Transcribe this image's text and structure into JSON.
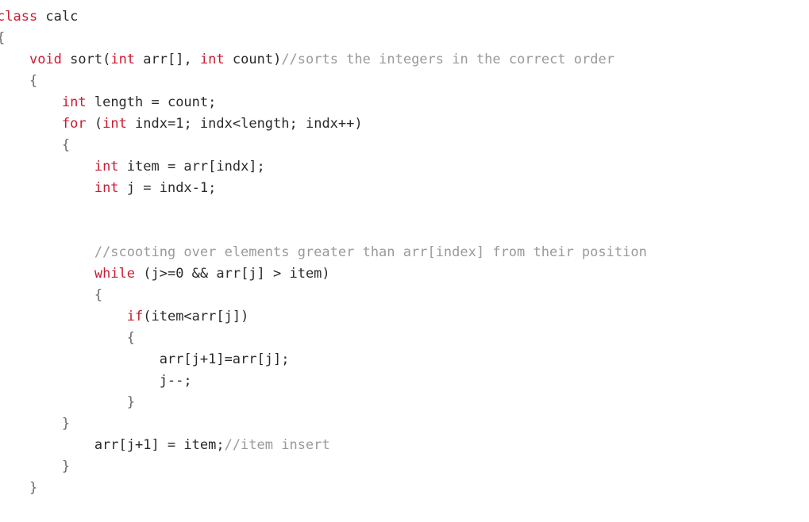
{
  "colors": {
    "background": "#ffffff",
    "keyword": "#cc1b30",
    "comment": "#9a9a9a",
    "text": "#2a2a2a",
    "punctuation": "#6a6a6a"
  },
  "code": {
    "lines": [
      [
        {
          "t": "kw",
          "v": "class"
        },
        {
          "t": "plain",
          "v": " calc"
        }
      ],
      [
        {
          "t": "punct",
          "v": "{"
        }
      ],
      [
        {
          "t": "plain",
          "v": "    "
        },
        {
          "t": "kw",
          "v": "void"
        },
        {
          "t": "plain",
          "v": " sort("
        },
        {
          "t": "kw",
          "v": "int"
        },
        {
          "t": "plain",
          "v": " arr[], "
        },
        {
          "t": "kw",
          "v": "int"
        },
        {
          "t": "plain",
          "v": " count)"
        },
        {
          "t": "cm",
          "v": "//sorts the integers in the correct order"
        }
      ],
      [
        {
          "t": "plain",
          "v": "    "
        },
        {
          "t": "punct",
          "v": "{"
        }
      ],
      [
        {
          "t": "plain",
          "v": "        "
        },
        {
          "t": "kw",
          "v": "int"
        },
        {
          "t": "plain",
          "v": " length = count;"
        }
      ],
      [
        {
          "t": "plain",
          "v": "        "
        },
        {
          "t": "kw",
          "v": "for"
        },
        {
          "t": "plain",
          "v": " ("
        },
        {
          "t": "kw",
          "v": "int"
        },
        {
          "t": "plain",
          "v": " indx=1; indx<length; indx++)"
        }
      ],
      [
        {
          "t": "plain",
          "v": "        "
        },
        {
          "t": "punct",
          "v": "{"
        }
      ],
      [
        {
          "t": "plain",
          "v": "            "
        },
        {
          "t": "kw",
          "v": "int"
        },
        {
          "t": "plain",
          "v": " item = arr[indx];"
        }
      ],
      [
        {
          "t": "plain",
          "v": "            "
        },
        {
          "t": "kw",
          "v": "int"
        },
        {
          "t": "plain",
          "v": " j = indx-1;"
        }
      ],
      [],
      [],
      [
        {
          "t": "plain",
          "v": "            "
        },
        {
          "t": "cm",
          "v": "//scooting over elements greater than arr[index] from their position"
        }
      ],
      [
        {
          "t": "plain",
          "v": "            "
        },
        {
          "t": "kw",
          "v": "while"
        },
        {
          "t": "plain",
          "v": " (j>=0 && arr[j] > item)"
        }
      ],
      [
        {
          "t": "plain",
          "v": "            "
        },
        {
          "t": "punct",
          "v": "{"
        }
      ],
      [
        {
          "t": "plain",
          "v": "                "
        },
        {
          "t": "kw",
          "v": "if"
        },
        {
          "t": "plain",
          "v": "(item<arr[j])"
        }
      ],
      [
        {
          "t": "plain",
          "v": "                "
        },
        {
          "t": "punct",
          "v": "{"
        }
      ],
      [
        {
          "t": "plain",
          "v": "                    arr[j+1]=arr[j];"
        }
      ],
      [
        {
          "t": "plain",
          "v": "                    j--;"
        }
      ],
      [
        {
          "t": "plain",
          "v": "                "
        },
        {
          "t": "punct",
          "v": "}"
        }
      ],
      [
        {
          "t": "plain",
          "v": "        "
        },
        {
          "t": "punct",
          "v": "}"
        }
      ],
      [
        {
          "t": "plain",
          "v": "            arr[j+1] = item;"
        },
        {
          "t": "cm",
          "v": "//item insert"
        }
      ],
      [
        {
          "t": "plain",
          "v": "        "
        },
        {
          "t": "punct",
          "v": "}"
        }
      ],
      [
        {
          "t": "plain",
          "v": "    "
        },
        {
          "t": "punct",
          "v": "}"
        }
      ]
    ]
  }
}
